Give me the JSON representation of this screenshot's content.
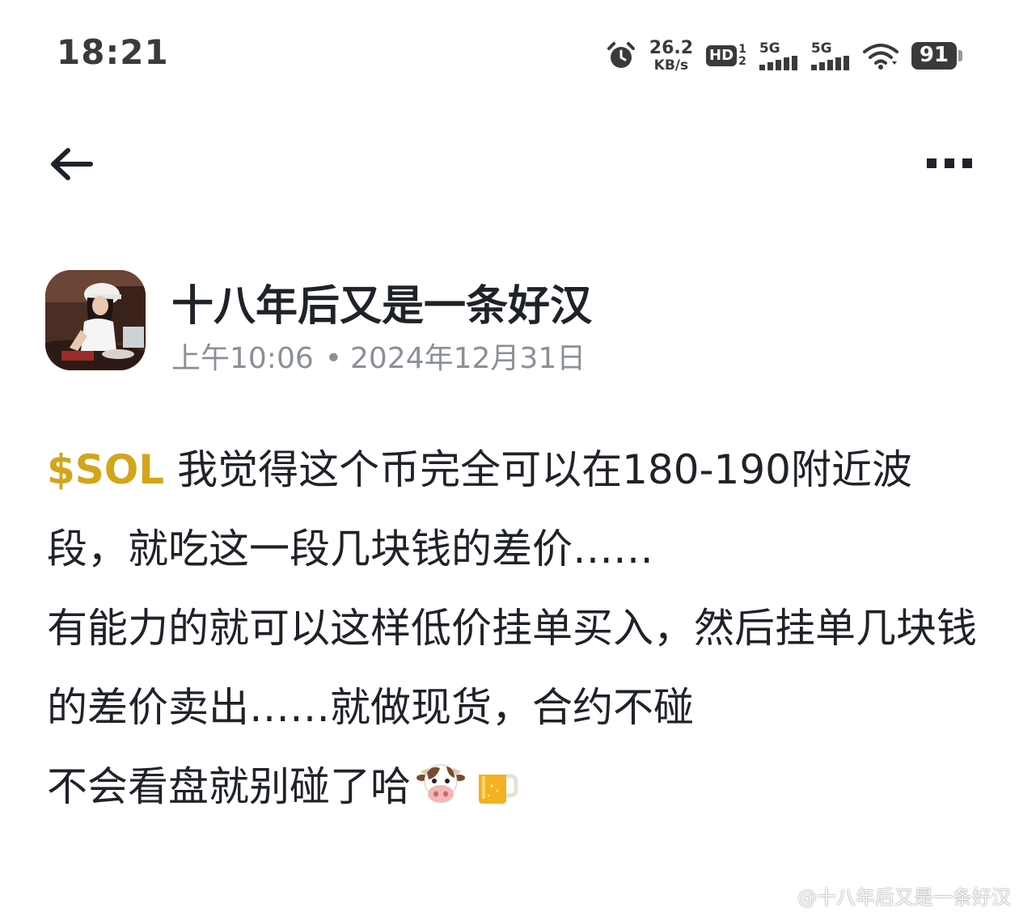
{
  "status_bar": {
    "time": "18:21",
    "net_speed_value": "26.2",
    "net_speed_unit": "KB/s",
    "hd_label": "HD",
    "hd_sim1": "1",
    "hd_sim2": "2",
    "sim1_network": "5G",
    "sim2_network": "5G",
    "battery_level": "91",
    "icons": [
      "alarm-icon",
      "wifi-icon",
      "signal-icon",
      "battery-icon"
    ]
  },
  "toolbar": {
    "back_icon": "arrow-left-icon",
    "more_icon": "more-dots-icon"
  },
  "author": {
    "name": "十八年后又是一条好汉",
    "avatar": "avatar"
  },
  "meta": {
    "time": "上午10:06",
    "separator": "•",
    "date": "2024年12月31日"
  },
  "post": {
    "ticker": "$SOL",
    "line1_rest": " 我觉得这个币完全可以在180-190附近波段，就吃这一段几块钱的差价……",
    "line2": "有能力的就可以这样低价挂单买入，然后挂单几块钱的差价卖出……就做现货，合约不碰",
    "line3": "不会看盘就别碰了哈",
    "emojis": [
      "cow-face-emoji",
      "beer-mug-emoji"
    ]
  },
  "watermark": {
    "text": "@十八年后又是一条好汉",
    "icon": "platform-logo-icon"
  },
  "colors": {
    "ticker": "#d4a51a",
    "text_primary": "#1e2329",
    "text_secondary": "#8a9097",
    "status_icons": "#3a3a3a"
  }
}
